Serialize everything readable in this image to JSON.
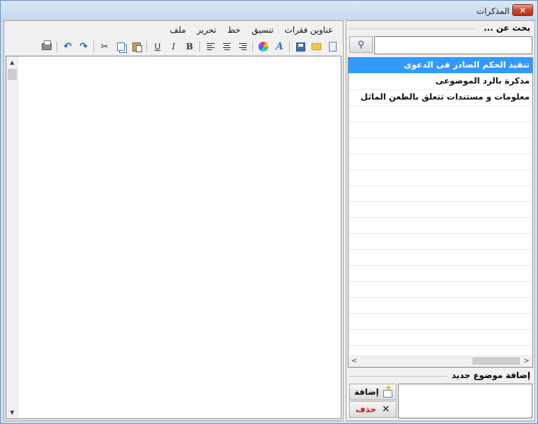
{
  "window": {
    "title": "المذكرات",
    "close_label": "✕"
  },
  "editor": {
    "menu": [
      "ملف",
      "تحرير",
      "خط",
      "تنسيق",
      "عناوين فقرات"
    ],
    "toolbar": {
      "bold": "B",
      "italic": "I",
      "underline": "U",
      "font_style": "A"
    }
  },
  "search": {
    "label": "بحث عن ...",
    "value": "",
    "button_glyph": "🔍"
  },
  "topics": [
    "تنفيذ الحكم الصادر فى الدعوى",
    "مذكرة بالرد الموضوعى",
    "معلومات و مستندات تتعلق بالطعن الماثل"
  ],
  "selected_topic_index": 0,
  "new_topic": {
    "label": "إضافة موضوع جديد",
    "value": "",
    "add_label": "إضافة",
    "delete_label": "حذف"
  }
}
